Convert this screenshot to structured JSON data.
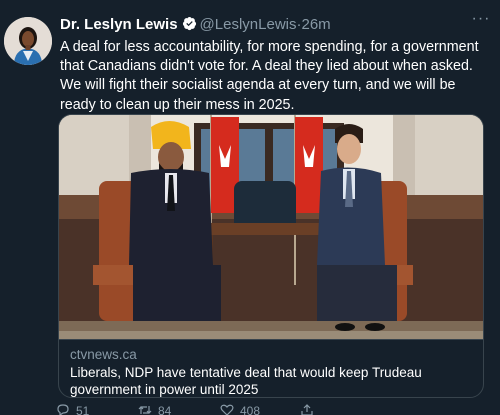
{
  "tweet": {
    "display_name": "Dr. Leslyn Lewis",
    "handle": "@LeslynLewis",
    "separator": "·",
    "time": "26m",
    "text": "A deal for less accountability, for more spending, for a government that Canadians didn't vote for. A deal they lied about when asked. We will fight their socialist agenda at every turn, and we will be ready to clean up their mess in 2025."
  },
  "card": {
    "domain": "ctvnews.ca",
    "title": "Liberals, NDP have tentative deal that would keep Trudeau government in power until 2025"
  },
  "actions": {
    "replies": "51",
    "retweets": "84",
    "likes": "408"
  },
  "colors": {
    "background": "#15202b",
    "secondary_text": "#8899a6",
    "border": "#38444d",
    "verified_badge": "#ffffff",
    "turban": "#f2b51c",
    "flag_red": "#d52b1e"
  },
  "icons": [
    "verified-badge-icon",
    "more-options-icon",
    "reply-icon",
    "retweet-icon",
    "like-icon",
    "share-icon"
  ]
}
